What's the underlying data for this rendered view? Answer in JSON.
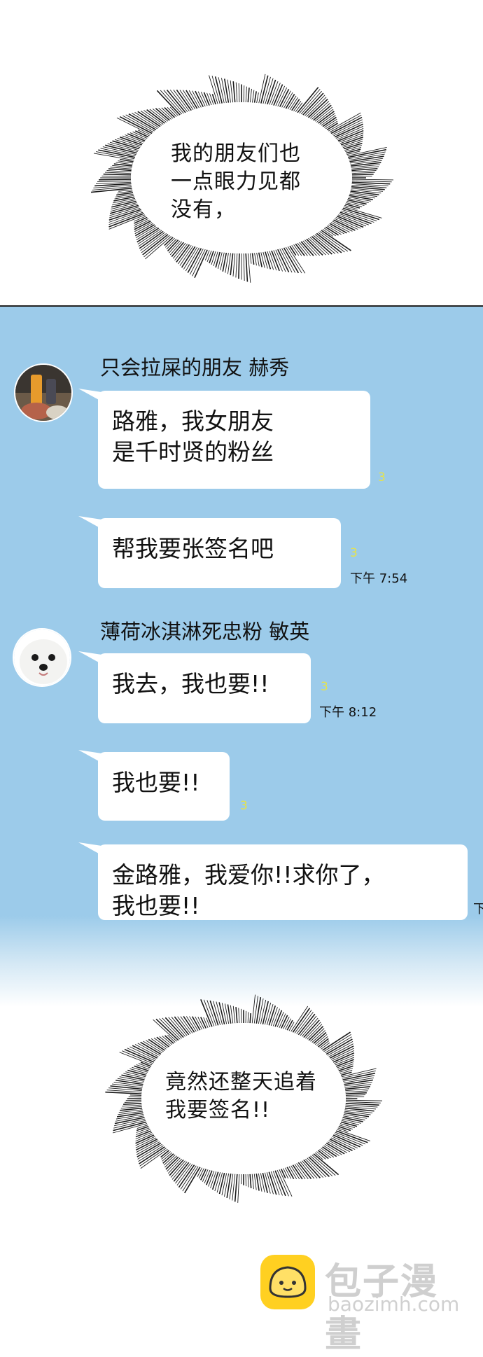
{
  "top_caption": "我的朋友们也\n一点眼力见都\n没有，",
  "chat": {
    "sender1": {
      "name": "只会拉屎的朋友 赫秀",
      "messages": [
        {
          "text": "路雅，我女朋友\n是千时贤的粉丝",
          "read": "3"
        },
        {
          "text": "帮我要张签名吧",
          "read": "3",
          "time": "下午  7:54"
        }
      ]
    },
    "sender2": {
      "name": "薄荷冰淇淋死忠粉 敏英",
      "messages": [
        {
          "text": "我去，我也要!!",
          "read": "3",
          "time": "下午  8:12"
        },
        {
          "text": "我也要!!",
          "read": "3"
        },
        {
          "text": "金路雅，我爱你!!求你了，\n我也要!!",
          "time_partial": "下"
        }
      ]
    }
  },
  "bottom_caption": "竟然还整天追着\n我要签名!!",
  "watermark": {
    "title": "包子漫畫",
    "url": "baozimh.com",
    "icon": "bun-icon",
    "icon_color": "#ffd021"
  },
  "colors": {
    "chat_background": "#9ccbea",
    "bubble": "#ffffff",
    "read_count": "#e6e34a"
  }
}
